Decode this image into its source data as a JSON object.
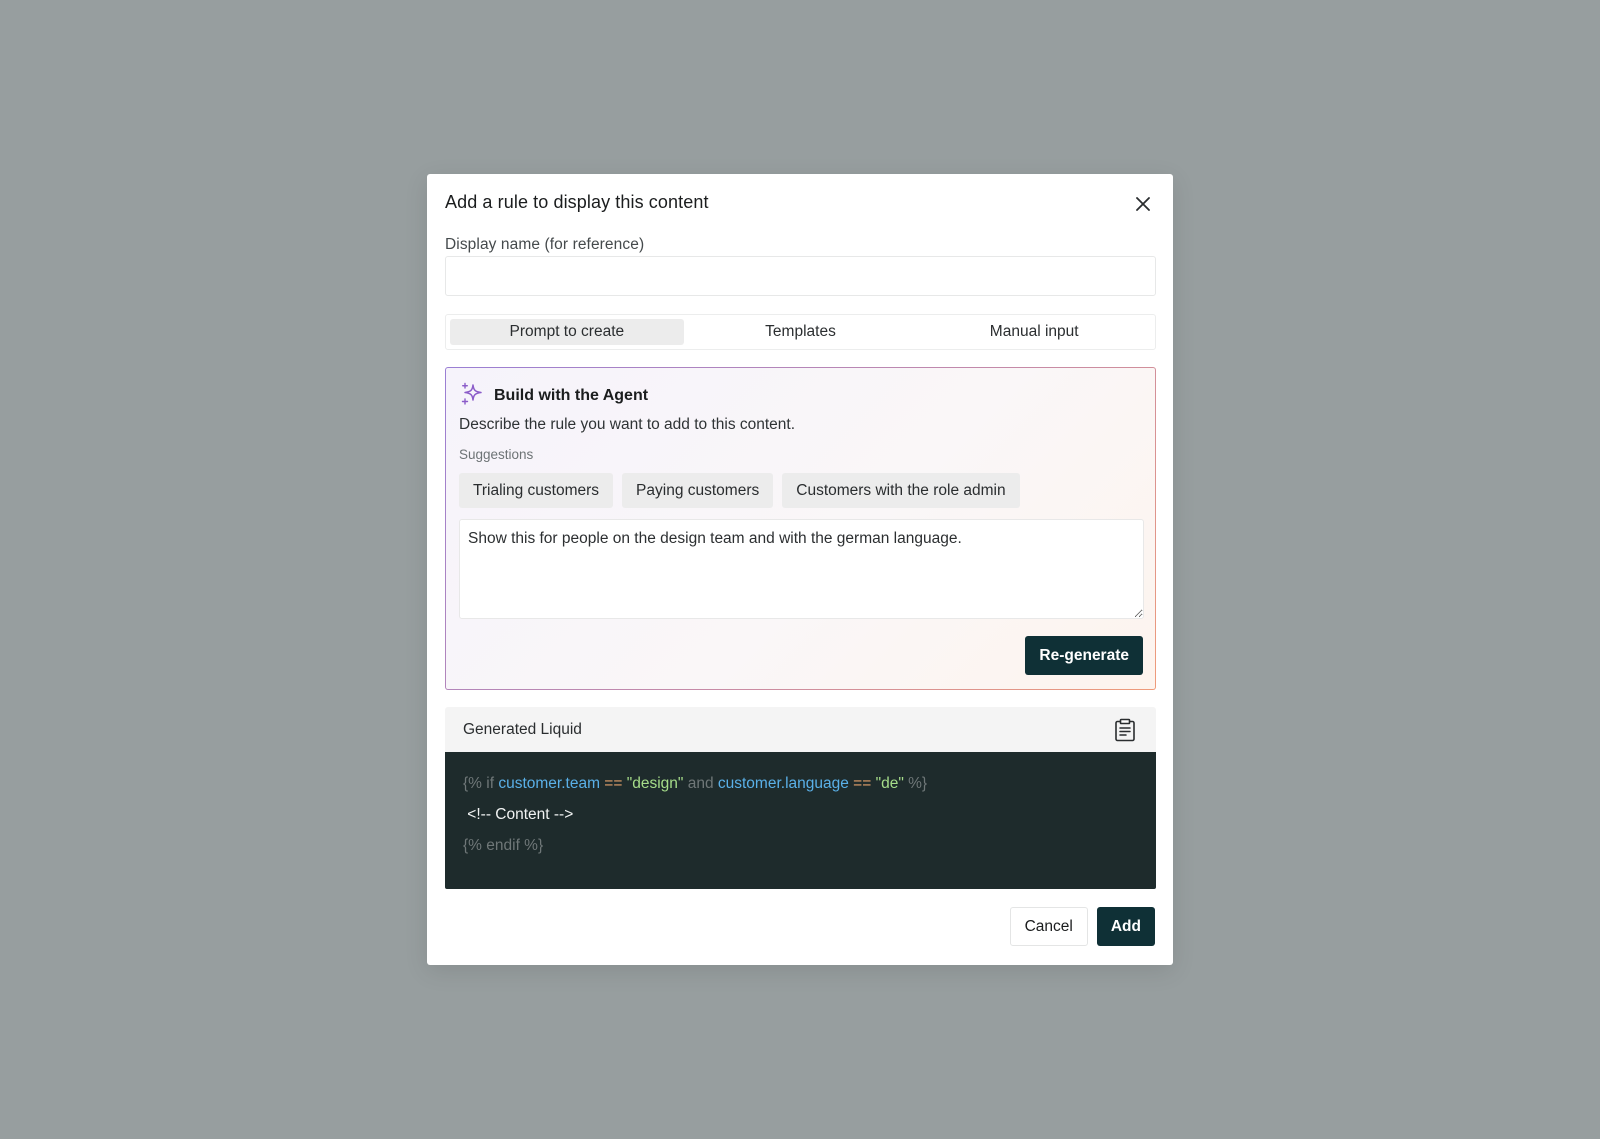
{
  "modal": {
    "title": "Add a rule to display this content",
    "close_icon": "close-icon"
  },
  "display_name": {
    "label": "Display name (for reference)",
    "value": "",
    "placeholder": ""
  },
  "tabs": [
    {
      "label": "Prompt to create",
      "active": true
    },
    {
      "label": "Templates",
      "active": false
    },
    {
      "label": "Manual input",
      "active": false
    }
  ],
  "agent": {
    "icon": "sparkle-icon",
    "title": "Build with the Agent",
    "description": "Describe the rule you want to add to this content.",
    "suggestions_label": "Suggestions",
    "suggestions": [
      "Trialing customers",
      "Paying customers",
      "Customers with the role admin"
    ],
    "prompt_value": "Show this for people on the design team and with the german language.",
    "regenerate_label": "Re-generate",
    "gradient_colors": [
      "#9a7fd4",
      "#ef9b7a"
    ]
  },
  "liquid": {
    "title": "Generated Liquid",
    "copy_icon": "clipboard-icon",
    "code": {
      "line1": {
        "open_tag": "{% if ",
        "var1": "customer.team",
        "op1": " == ",
        "str1": "\"design\"",
        "and": " and ",
        "var2": "customer.language",
        "op2": " == ",
        "str2": "\"de\"",
        "close_tag": " %}"
      },
      "line2": " <!-- Content -->",
      "line3": "{% endif %}"
    },
    "colors": {
      "background": "#1e2b2c",
      "tag": "#6f7778",
      "variable": "#5ab0e8",
      "operator": "#e3a06b",
      "string": "#a6dd8a"
    }
  },
  "footer": {
    "cancel_label": "Cancel",
    "add_label": "Add"
  },
  "colors": {
    "backdrop": "#979e9f",
    "primary_button": "#0f3036"
  }
}
